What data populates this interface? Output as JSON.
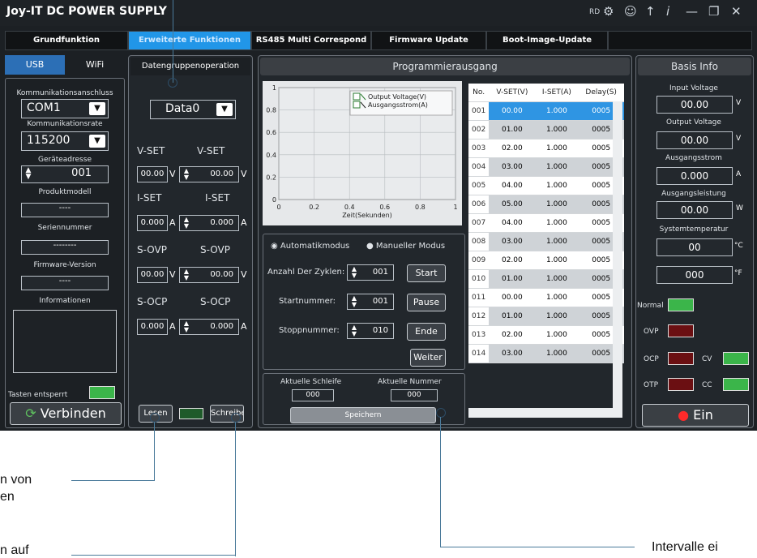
{
  "app": {
    "title": "Joy-IT DC POWER SUPPLY"
  },
  "titlebar": {
    "rd_label": "RD",
    "icons": [
      "gear-icon",
      "user-icon",
      "upload-icon",
      "info-icon",
      "minimize-icon",
      "restore-icon",
      "close-icon"
    ]
  },
  "tabs": [
    {
      "label": "Grundfunktion",
      "active": false
    },
    {
      "label": "Erweiterte Funktionen",
      "active": true
    },
    {
      "label": "RS485 Multi Correspond",
      "active": false
    },
    {
      "label": "Firmware Update",
      "active": false
    },
    {
      "label": "Boot-Image-Update",
      "active": false
    }
  ],
  "left": {
    "tab_usb": "USB",
    "tab_wifi": "WiFi",
    "port_label": "Kommunikationsanschluss",
    "port_value": "COM1",
    "rate_label": "Kommunikationsrate",
    "rate_value": "115200",
    "addr_label": "Geräteadresse",
    "addr_value": "001",
    "model_label": "Produktmodell",
    "model_value": "----",
    "serial_label": "Seriennummer",
    "serial_value": "--------",
    "fw_label": "Firmware-Version",
    "fw_value": "----",
    "info_label": "Informationen",
    "keys_label": "Tasten entsperrt",
    "connect_label": "Verbinden"
  },
  "group": {
    "header": "Datengruppenoperation",
    "data_value": "Data0",
    "vset": "V-SET",
    "iset": "I-SET",
    "sovp": "S-OVP",
    "socp": "S-OCP",
    "vset_a": "00.00",
    "vset_b": "00.00",
    "iset_a": "0.000",
    "iset_b": "0.000",
    "sovp_a": "00.00",
    "sovp_b": "00.00",
    "socp_a": "0.000",
    "socp_b": "0.000",
    "unit_v": "V",
    "unit_a": "A",
    "read_label": "Lesen",
    "write_label": "Schreiben"
  },
  "program": {
    "header": "Programmierausgang",
    "legend_voltage": "Output Voltage(V)",
    "legend_current": "Ausgangsstrom(A)",
    "xlabel": "Zeit(Sekunden)",
    "mode_auto": "Automatikmodus",
    "mode_manual": "Manueller Modus",
    "cycles_label": "Anzahl Der Zyklen:",
    "cycles_value": "001",
    "start_label": "Startnummer:",
    "start_value": "001",
    "stop_label": "Stoppnummer:",
    "stop_value": "010",
    "btn_start": "Start",
    "btn_pause": "Pause",
    "btn_end": "Ende",
    "btn_next": "Weiter",
    "cur_loop_label": "Aktuelle Schleife",
    "cur_loop_value": "000",
    "cur_num_label": "Aktuelle Nummer",
    "cur_num_value": "000",
    "save_label": "Speichern"
  },
  "chart_data": {
    "type": "line",
    "title": "",
    "xlabel": "Zeit(Sekunden)",
    "ylabel": "",
    "xlim": [
      0,
      1
    ],
    "ylim": [
      0,
      1
    ],
    "x_ticks": [
      "0",
      "0.2",
      "0.4",
      "0.6",
      "0.8",
      "1"
    ],
    "y_ticks": [
      "0",
      "0.2",
      "0.4",
      "0.6",
      "0.8",
      "1"
    ],
    "grid": true,
    "legend_position": "top-right",
    "series": [
      {
        "name": "Output Voltage(V)",
        "values": []
      },
      {
        "name": "Ausgangsstrom(A)",
        "values": []
      }
    ]
  },
  "table": {
    "headers": [
      "No.",
      "V-SET(V)",
      "I-SET(A)",
      "Delay(S)"
    ],
    "rows": [
      [
        "001",
        "00.00",
        "1.000",
        "0005"
      ],
      [
        "002",
        "01.00",
        "1.000",
        "0005"
      ],
      [
        "003",
        "02.00",
        "1.000",
        "0005"
      ],
      [
        "004",
        "03.00",
        "1.000",
        "0005"
      ],
      [
        "005",
        "04.00",
        "1.000",
        "0005"
      ],
      [
        "006",
        "05.00",
        "1.000",
        "0005"
      ],
      [
        "007",
        "04.00",
        "1.000",
        "0005"
      ],
      [
        "008",
        "03.00",
        "1.000",
        "0005"
      ],
      [
        "009",
        "02.00",
        "1.000",
        "0005"
      ],
      [
        "010",
        "01.00",
        "1.000",
        "0005"
      ],
      [
        "011",
        "00.00",
        "1.000",
        "0005"
      ],
      [
        "012",
        "01.00",
        "1.000",
        "0005"
      ],
      [
        "013",
        "02.00",
        "1.000",
        "0005"
      ],
      [
        "014",
        "03.00",
        "1.000",
        "0005"
      ]
    ]
  },
  "basis": {
    "header": "Basis Info",
    "in_v_label": "Input Voltage",
    "in_v": "00.00",
    "unit_v": "V",
    "out_v_label": "Output Voltage",
    "out_v": "00.00",
    "out_i_label": "Ausgangsstrom",
    "out_i": "0.000",
    "unit_a": "A",
    "out_p_label": "Ausgangsleistung",
    "out_p": "00.00",
    "unit_w": "W",
    "temp_label": "Systemtemperatur",
    "temp_c": "00",
    "unit_c": "°C",
    "temp_f": "000",
    "unit_f": "°F",
    "normal": "Normal",
    "ovp": "OVP",
    "ocp": "OCP",
    "otp": "OTP",
    "cv": "CV",
    "cc": "CC",
    "on_label": "Ein"
  },
  "annotations": {
    "a1": "n von",
    "a2": "en",
    "a3": "n auf",
    "a4": "Intervalle ei"
  }
}
